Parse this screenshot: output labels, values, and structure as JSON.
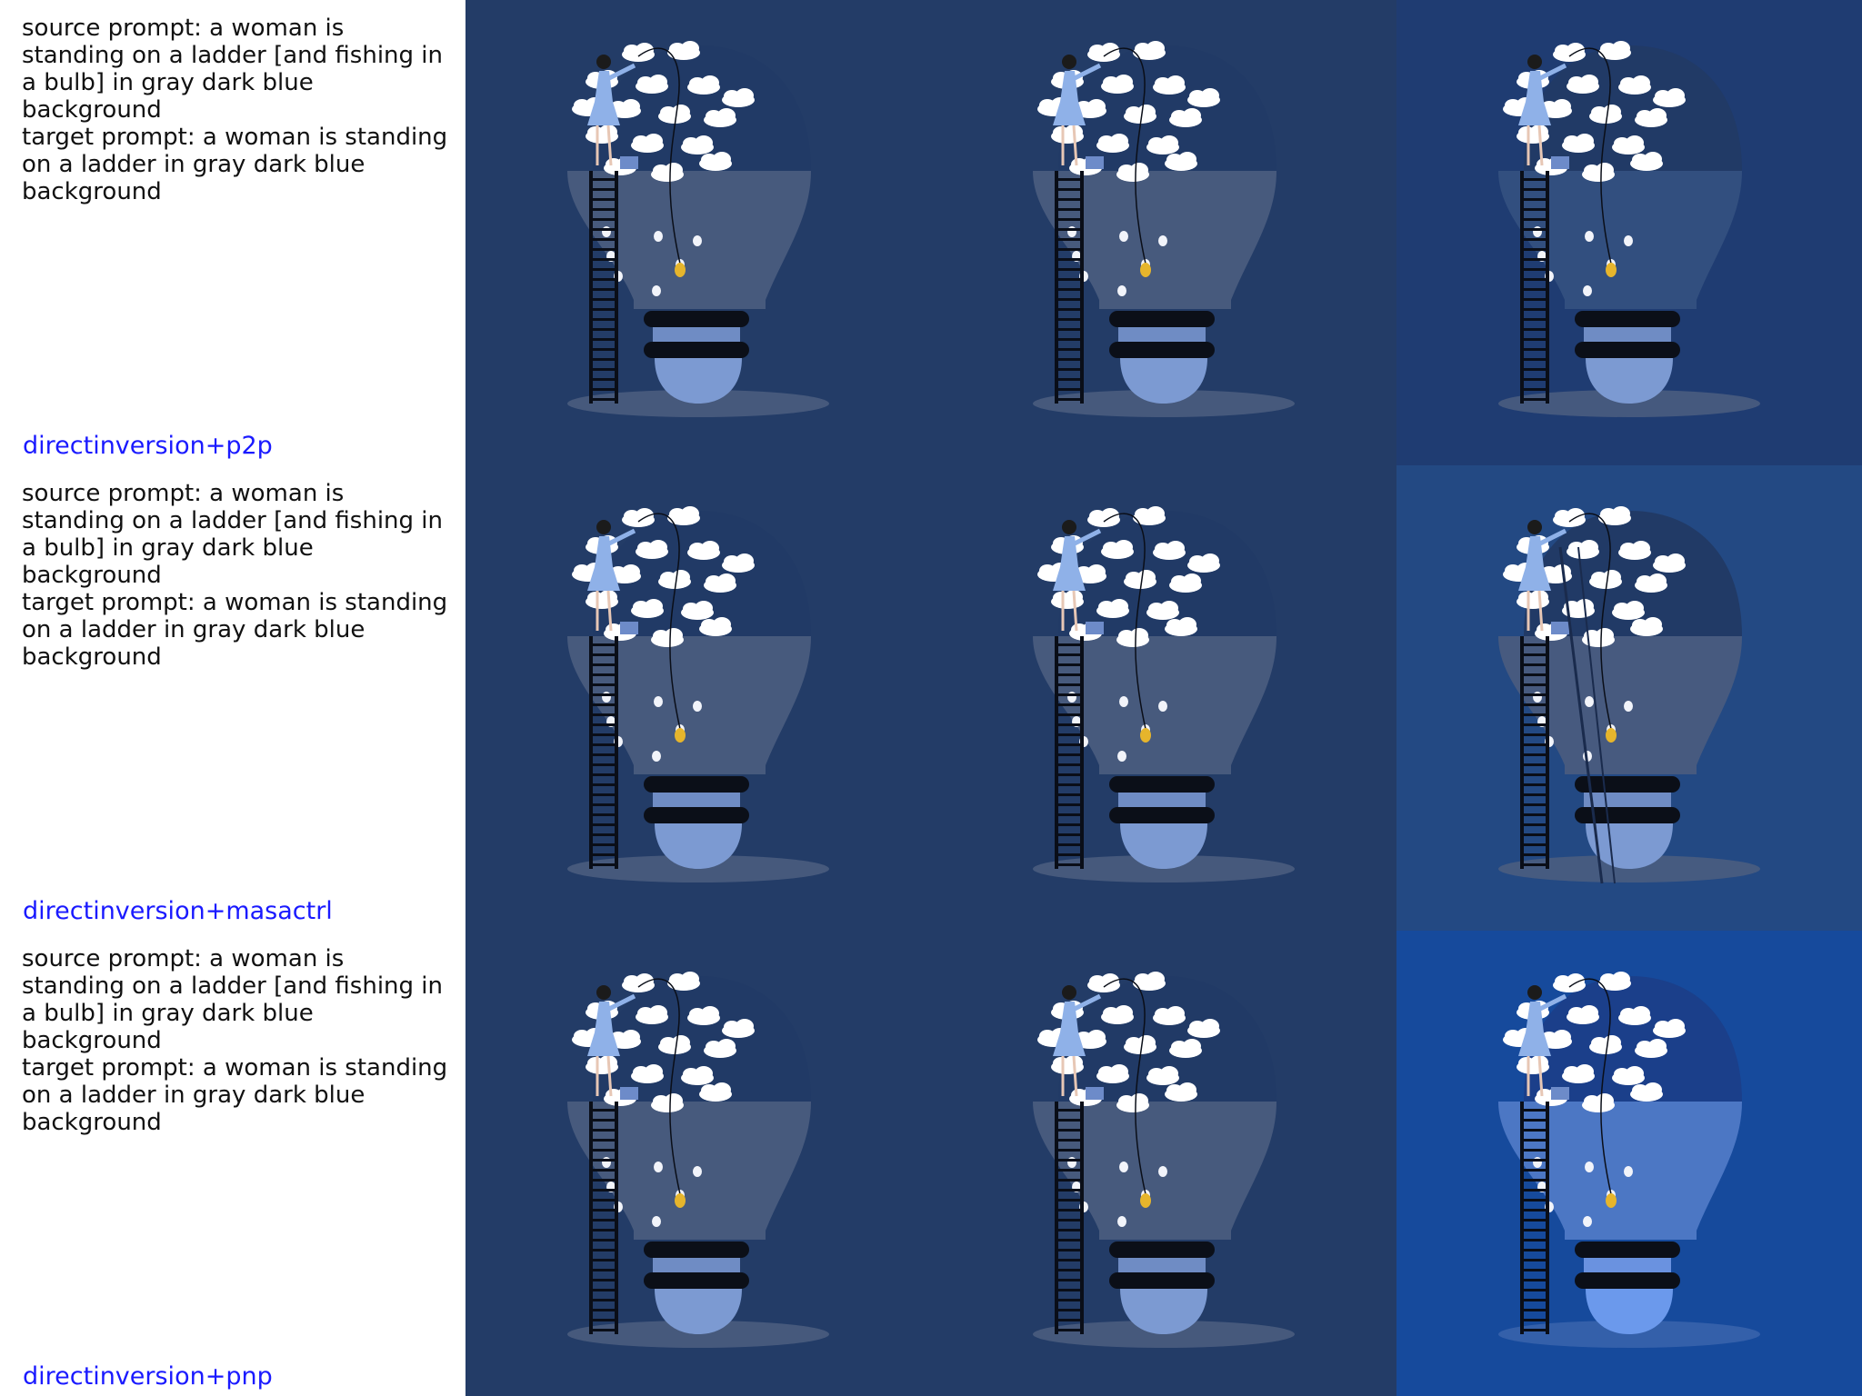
{
  "rows": [
    {
      "source_prompt": "source prompt: a woman is standing on a ladder [and fishing in a bulb] in gray dark blue background",
      "target_prompt": "target prompt: a woman is standing on a ladder in gray dark blue background",
      "method": "directinversion+p2p",
      "images": [
        {
          "bg": "#233c67",
          "variant": "source"
        },
        {
          "bg": "#233c67",
          "variant": "reconstruction"
        },
        {
          "bg": "#1f3c72",
          "variant": "edited"
        }
      ]
    },
    {
      "source_prompt": "source prompt: a woman is standing on a ladder [and fishing in a bulb] in gray dark blue background",
      "target_prompt": "target prompt: a woman is standing on a ladder in gray dark blue background",
      "method": "directinversion+masactrl",
      "images": [
        {
          "bg": "#233c67",
          "variant": "source"
        },
        {
          "bg": "#233c67",
          "variant": "reconstruction"
        },
        {
          "bg": "#234983",
          "variant": "edited-ladder"
        }
      ]
    },
    {
      "source_prompt": "source prompt: a woman is standing on a ladder [and fishing in a bulb] in gray dark blue background",
      "target_prompt": "target prompt: a woman is standing on a ladder in gray dark blue background",
      "method": "directinversion+pnp",
      "images": [
        {
          "bg": "#233c67",
          "variant": "source"
        },
        {
          "bg": "#233c67",
          "variant": "reconstruction"
        },
        {
          "bg": "#164a9c",
          "variant": "edited-bright"
        }
      ]
    }
  ]
}
